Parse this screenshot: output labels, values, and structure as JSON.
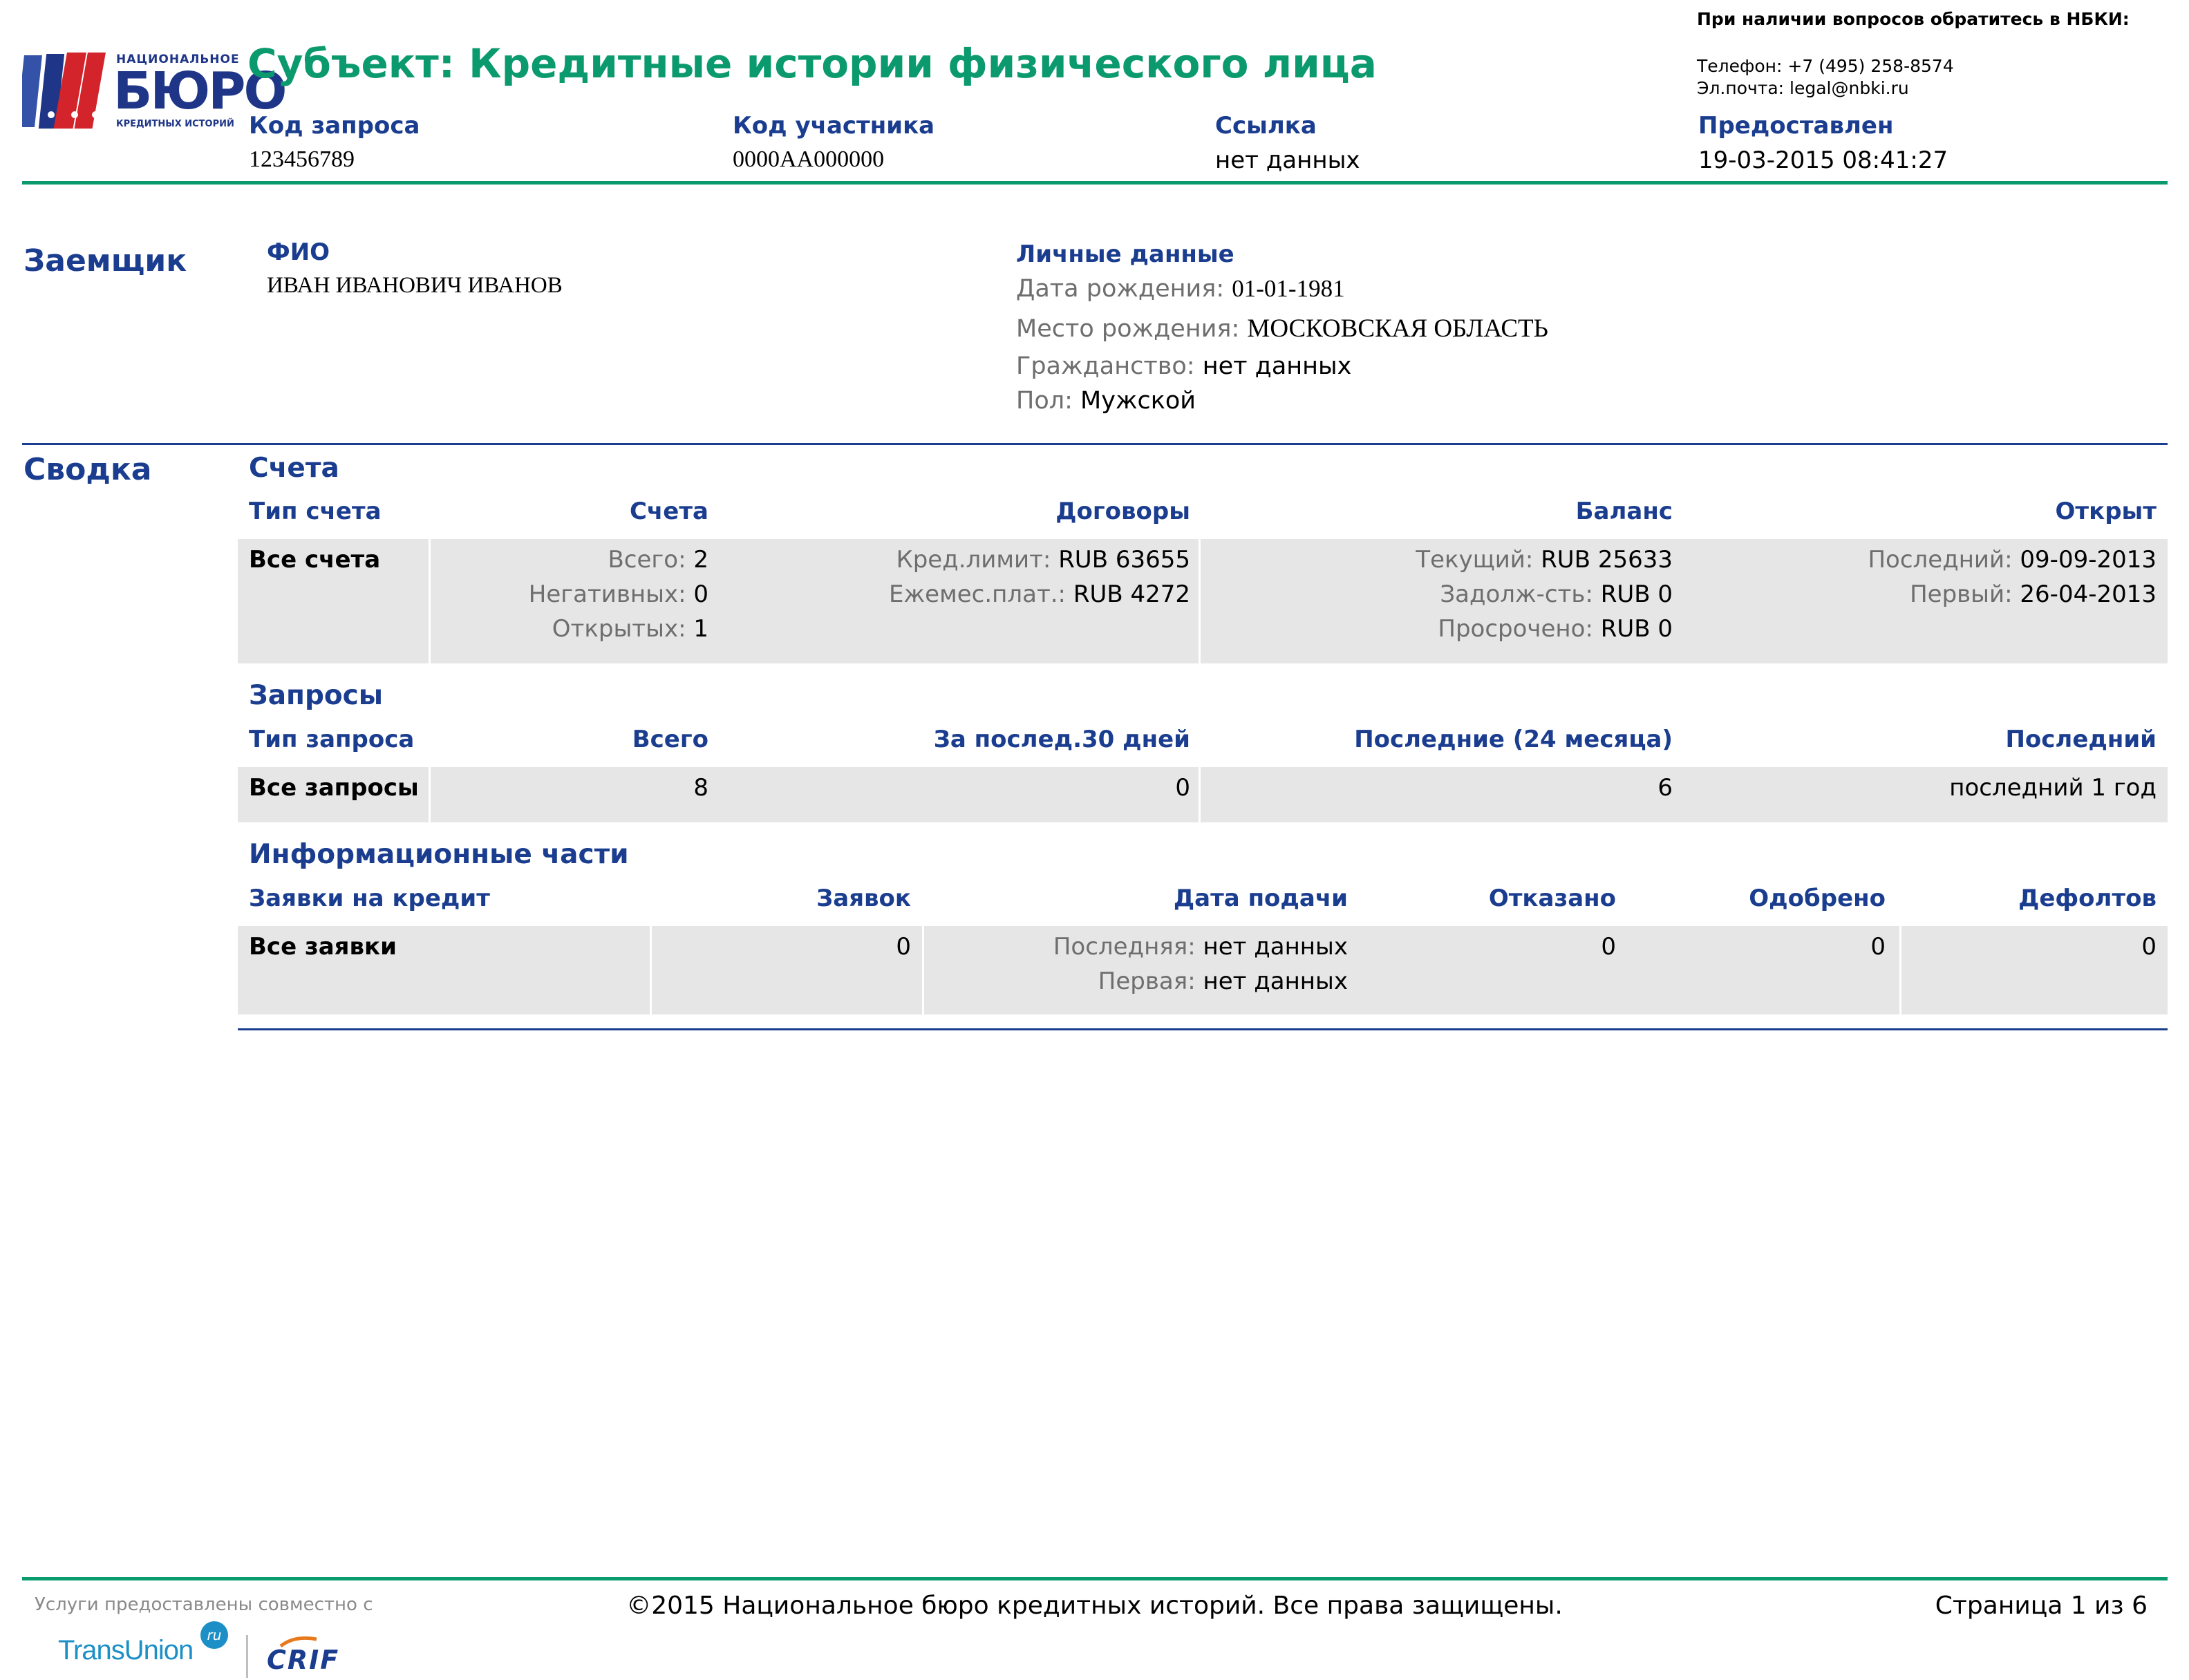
{
  "header": {
    "logo_text_top": "НАЦИОНАЛЬНОЕ",
    "logo_text_main": "БЮРО",
    "logo_text_bottom": "КРЕДИТНЫХ ИСТОРИЙ",
    "title": "Субъект: Кредитные истории физического лица",
    "contact_heading": "При наличии вопросов обратитесь в НБКИ:",
    "contact_phone": "Телефон: +7 (495) 258-8574",
    "contact_email": "Эл.почта: legal@nbki.ru",
    "fields": [
      {
        "label": "Код запроса",
        "value": "123456789"
      },
      {
        "label": "Код участника",
        "value": "0000AA000000"
      },
      {
        "label": "Ссылка",
        "value": "нет данных"
      },
      {
        "label": "Предоставлен",
        "value": "19-03-2015 08:41:27"
      }
    ]
  },
  "borrower": {
    "section_title": "Заемщик",
    "fio_label": "ФИО",
    "fio_value": "ИВАН ИВАНОВИЧ ИВАНОВ",
    "personal_label": "Личные данные",
    "personal": [
      {
        "label": "Дата рождения:",
        "value": "01-01-1981"
      },
      {
        "label": "Место рождения:",
        "value": "МОСКОВСКАЯ ОБЛАСТЬ"
      },
      {
        "label": "Гражданство:",
        "value": "нет данных"
      },
      {
        "label": "Пол:",
        "value": "Мужской"
      }
    ]
  },
  "summary": {
    "section_title": "Сводка",
    "accounts": {
      "title": "Счета",
      "headers": [
        "Тип счета",
        "Счета",
        "Договоры",
        "Баланс",
        "Открыт"
      ],
      "row_label": "Все счета",
      "accounts_col": [
        {
          "label": "Всего:",
          "value": "2"
        },
        {
          "label": "Негативных:",
          "value": "0"
        },
        {
          "label": "Открытых:",
          "value": "1"
        }
      ],
      "contracts_col": [
        {
          "label": "Кред.лимит:",
          "value": "RUB 63655"
        },
        {
          "label": "Ежемес.плат.:",
          "value": "RUB 4272"
        }
      ],
      "balance_col": [
        {
          "label": "Текущий:",
          "value": "RUB 25633"
        },
        {
          "label": "Задолж-сть:",
          "value": "RUB 0"
        },
        {
          "label": "Просрочено:",
          "value": "RUB 0"
        }
      ],
      "opened_col": [
        {
          "label": "Последний:",
          "value": "09-09-2013"
        },
        {
          "label": "Первый:",
          "value": "26-04-2013"
        }
      ]
    },
    "inquiries": {
      "title": "Запросы",
      "headers": [
        "Тип запроса",
        "Всего",
        "За послед.30 дней",
        "Последние (24 месяца)",
        "Последний"
      ],
      "row": [
        "Все запросы",
        "8",
        "0",
        "6",
        "последний 1 год"
      ]
    },
    "info_parts": {
      "title": "Информационные части",
      "headers": [
        "Заявки на кредит",
        "Заявок",
        "Дата подачи",
        "Отказано",
        "Одобрено",
        "Дефолтов"
      ],
      "row_label": "Все заявки",
      "applications": "0",
      "dates": [
        {
          "label": "Последняя:",
          "value": "нет данных"
        },
        {
          "label": "Первая:",
          "value": "нет данных"
        }
      ],
      "rejected": "0",
      "approved": "0",
      "defaults": "0"
    }
  },
  "footer": {
    "partners_label": "Услуги предоставлены совместно с",
    "transunion": "TransUnion",
    "transunion_badge": "ru",
    "crif": "CRIF",
    "copyright": "©2015 Национальное бюро кредитных историй. Все права защищены.",
    "page": "Страница 1 из 6"
  }
}
